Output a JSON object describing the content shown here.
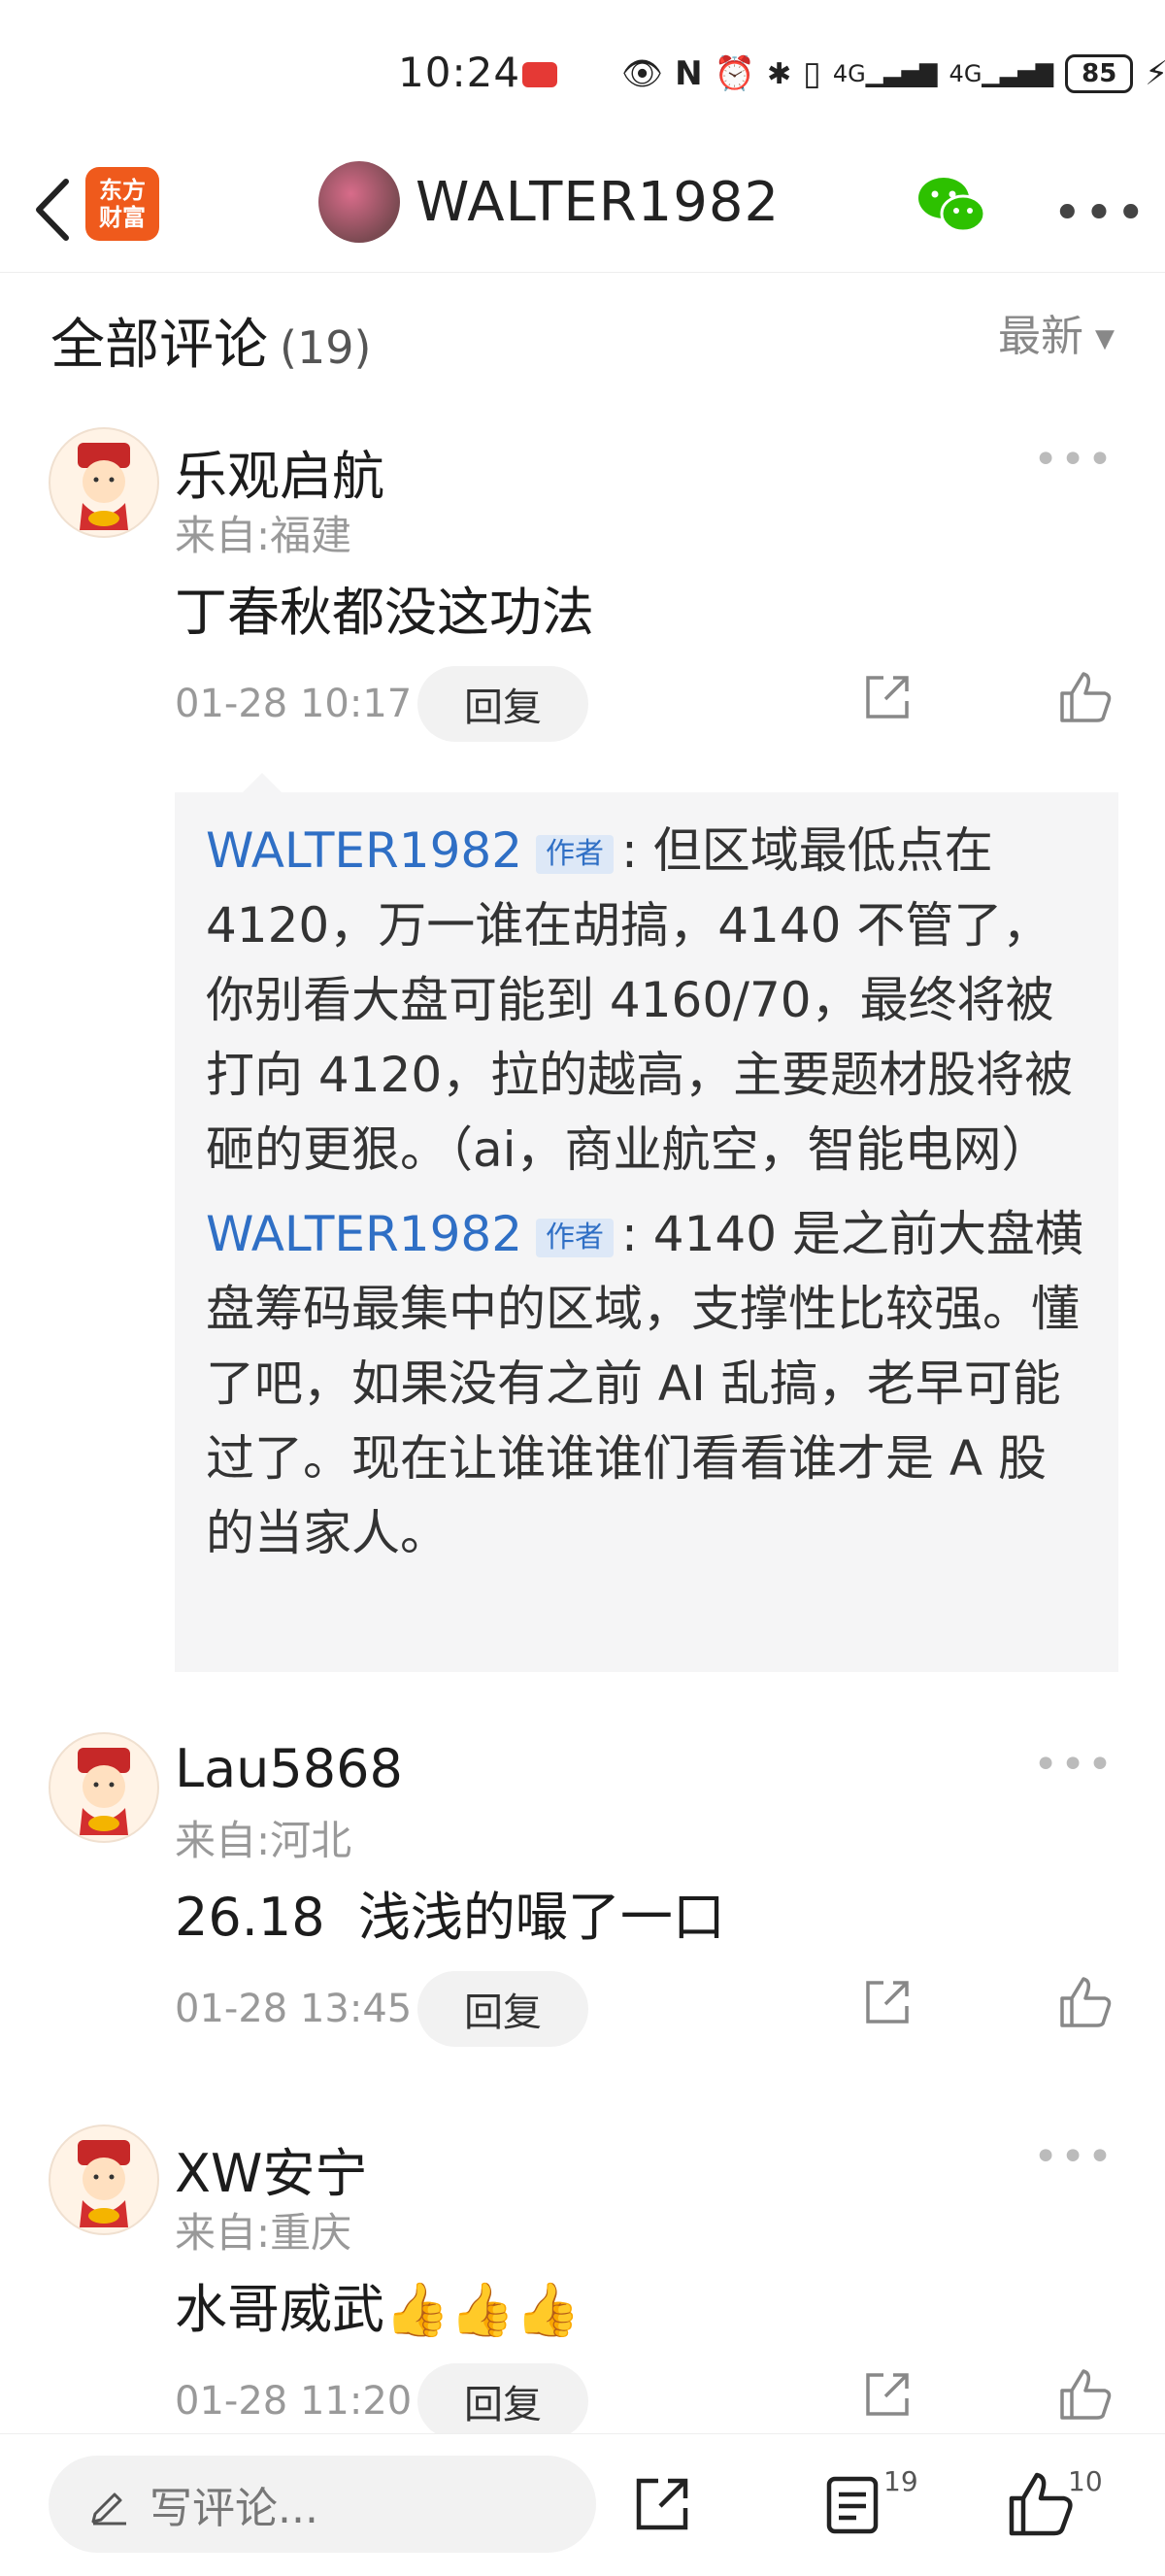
{
  "status_bar": {
    "time": "10:24",
    "battery": "85",
    "icons": [
      "eye-icon",
      "nfc-icon",
      "alarm-icon",
      "bluetooth-icon",
      "vibrate-icon",
      "signal-4g-icon",
      "signal-4g-icon",
      "charging-icon"
    ]
  },
  "header": {
    "logo_line1": "东方",
    "logo_line2": "财富",
    "username": "WALTER1982"
  },
  "comments_section": {
    "title": "全部评论",
    "count": "(19)",
    "sort_label": "最新"
  },
  "comments": [
    {
      "name": "乐观启航",
      "location": "来自:福建",
      "text": "丁春秋都没这功法",
      "time": "01-28 10:17",
      "reply_label": "回复",
      "replies": [
        {
          "name": "WALTER1982",
          "tag": "作者",
          "text": ": 但区域最低点在 4120，万一谁在胡搞，4140 不管了，你别看大盘可能到 4160/70，最终将被打向 4120，拉的越高，主要题材股将被砸的更狠。（ai，商业航空，智能电网）"
        },
        {
          "name": "WALTER1982",
          "tag": "作者",
          "text": ": 4140 是之前大盘横盘筹码最集中的区域，支撑性比较强。懂了吧，如果没有之前 AI 乱搞，老早可能过了。现在让谁谁谁们看看谁才是 A 股的当家人。"
        }
      ]
    },
    {
      "name": "Lau5868",
      "location": "来自:河北",
      "text": "26.18  浅浅的嘬了一口",
      "time": "01-28 13:45",
      "reply_label": "回复"
    },
    {
      "name": "XW安宁",
      "location": "来自:重庆",
      "text": "水哥威武👍👍👍",
      "time": "01-28 11:20",
      "reply_label": "回复"
    }
  ],
  "bottom_bar": {
    "input_placeholder": "写评论...",
    "comment_count": "19",
    "like_count": "10"
  }
}
